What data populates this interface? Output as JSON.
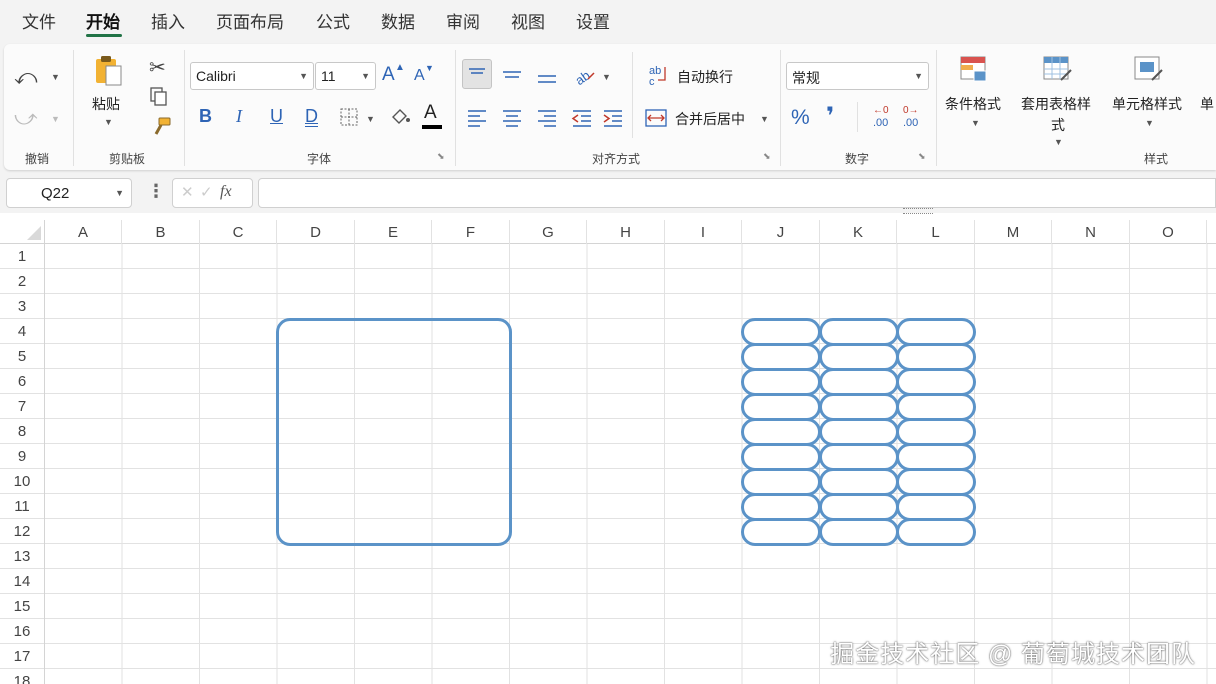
{
  "menu": {
    "items": [
      "文件",
      "开始",
      "插入",
      "页面布局",
      "公式",
      "数据",
      "审阅",
      "视图",
      "设置"
    ],
    "active": "开始"
  },
  "ribbon": {
    "undo_group": {
      "label": "撤销"
    },
    "clipboard": {
      "label": "剪贴板",
      "paste_label": "粘贴"
    },
    "font": {
      "label": "字体",
      "font_name": "Calibri",
      "font_size": "11",
      "bold": "B",
      "italic": "I",
      "underline": "U",
      "double_underline": "D",
      "grow": "A",
      "shrink": "A"
    },
    "alignment": {
      "label": "对齐方式",
      "wrap_text": "自动换行",
      "merge_center": "合并后居中"
    },
    "number": {
      "label": "数字",
      "format": "常规",
      "percent": "%",
      "comma": "❜",
      "inc_decimal": ".00",
      "dec_decimal": ".00",
      "inc_decimal_top": "←0",
      "dec_decimal_top": "0→"
    },
    "styles": {
      "label": "样式",
      "conditional": "条件格式",
      "table_style_line1": "套用表格样",
      "table_style_line2": "式",
      "cell_style": "单元格样式",
      "more": "单"
    }
  },
  "formula_bar": {
    "name_box": "Q22",
    "fx": "fx",
    "formula": ""
  },
  "sheet": {
    "columns": [
      "A",
      "B",
      "C",
      "D",
      "E",
      "F",
      "G",
      "H",
      "I",
      "J",
      "K",
      "L",
      "M",
      "N",
      "O"
    ],
    "rows": [
      "1",
      "2",
      "3",
      "4",
      "5",
      "6",
      "7",
      "8",
      "9",
      "10",
      "11",
      "12",
      "13",
      "14",
      "15",
      "16",
      "17",
      "18"
    ],
    "shape_color": "#5b93c8"
  },
  "watermark": "掘金技术社区 @ 葡萄城技术团队"
}
